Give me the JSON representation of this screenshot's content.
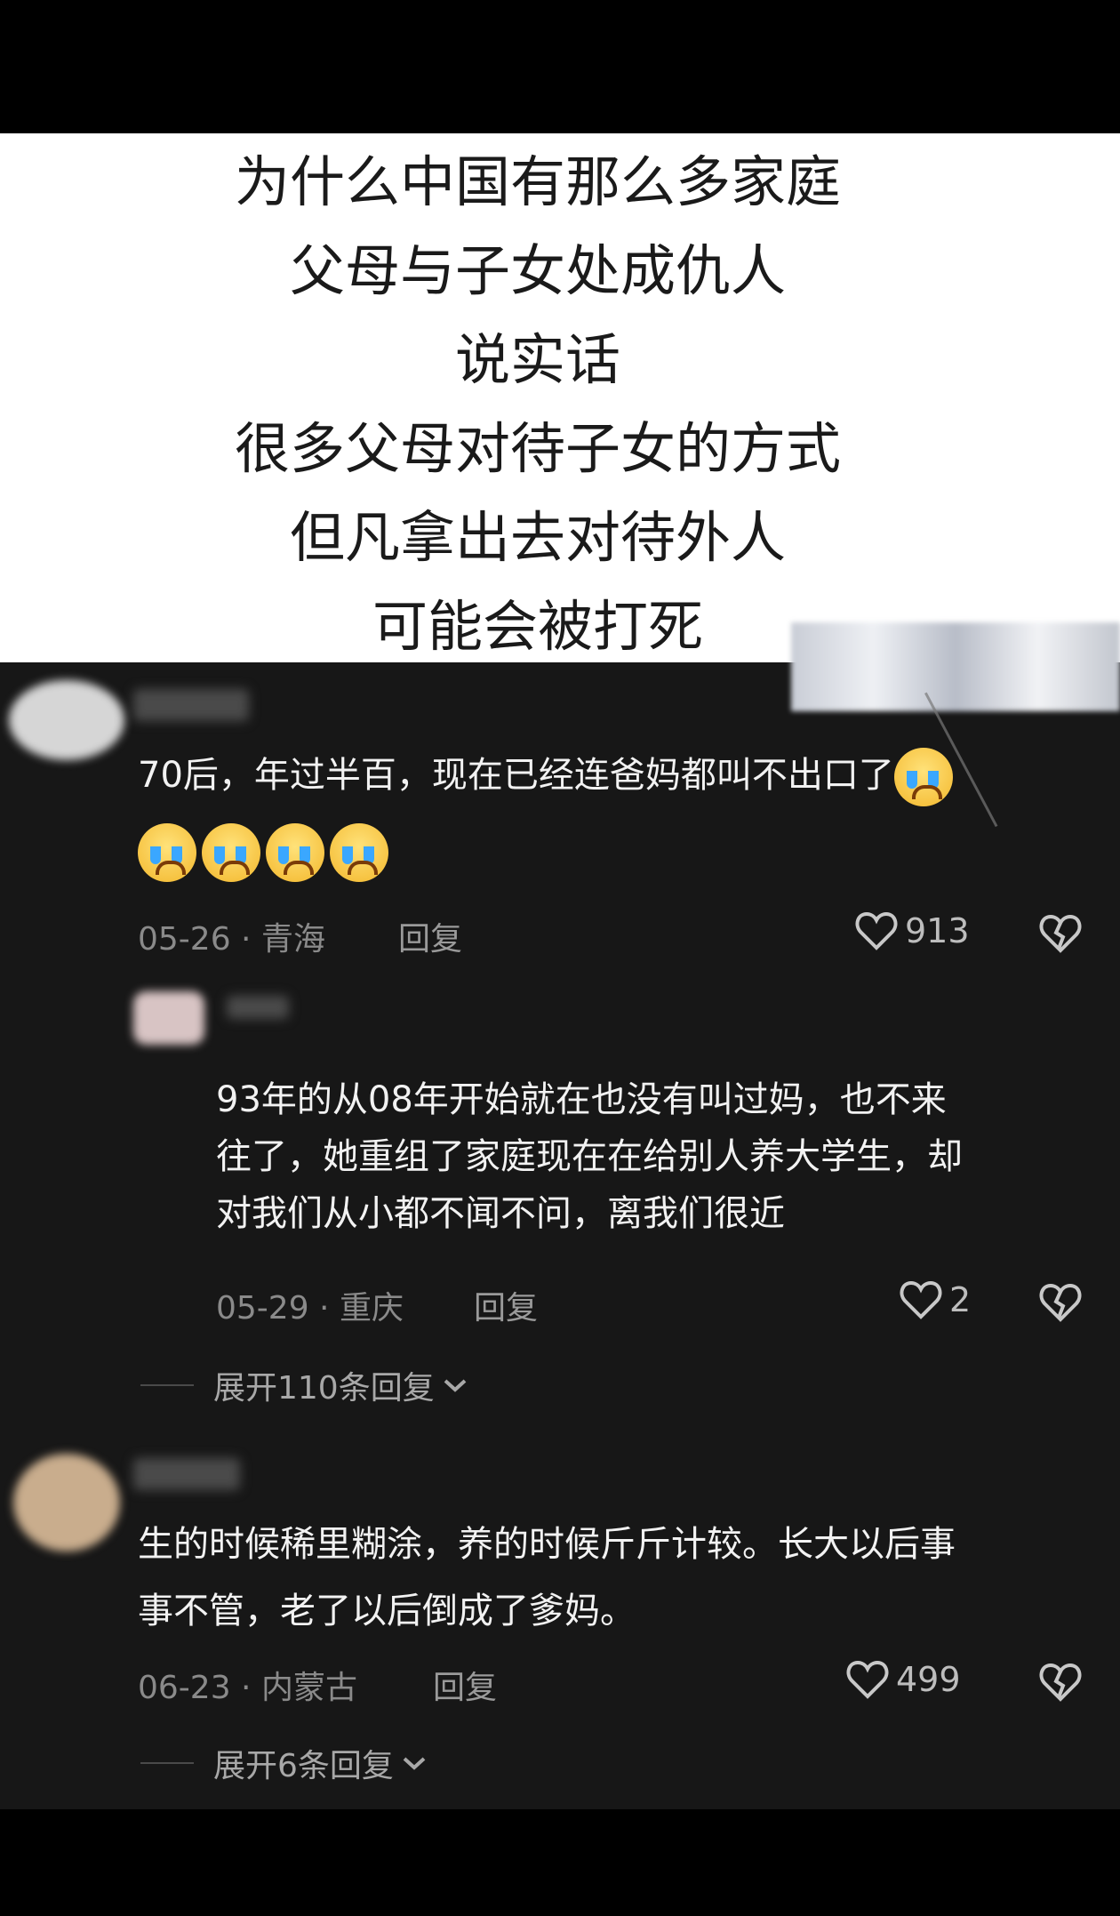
{
  "caption": {
    "lines": [
      "为什么中国有那么多家庭",
      "父母与子女处成仇人",
      "说实话",
      "很多父母对待子女的方式",
      "但凡拿出去对待外人",
      "可能会被打死"
    ]
  },
  "comments": [
    {
      "text_line1": "70后，年过半百，现在已经连爸妈都叫不出口了",
      "emoji_name": "crying-emoji",
      "date_location": "05-26 · 青海",
      "reply_label": "回复",
      "likes": "913"
    },
    {
      "text_line1": "93年的从08年开始就在也没有叫过妈，也不来",
      "text_line2": "往了，她重组了家庭现在在给别人养大学生，却",
      "text_line3": "对我们从小都不闻不问，离我们很近",
      "date_location": "05-29 · 重庆",
      "reply_label": "回复",
      "likes": "2"
    },
    {
      "text_line1": "生的时候稀里糊涂，养的时候斤斤计较。长大以后事",
      "text_line2": "事不管，老了以后倒成了爹妈。",
      "date_location": "06-23 · 内蒙古",
      "reply_label": "回复",
      "likes": "499"
    }
  ],
  "expand_replies": [
    "展开110条回复",
    "展开6条回复"
  ],
  "colors": {
    "background": "#171717",
    "text": "#f2f2f2",
    "meta": "#8a8a8a"
  }
}
